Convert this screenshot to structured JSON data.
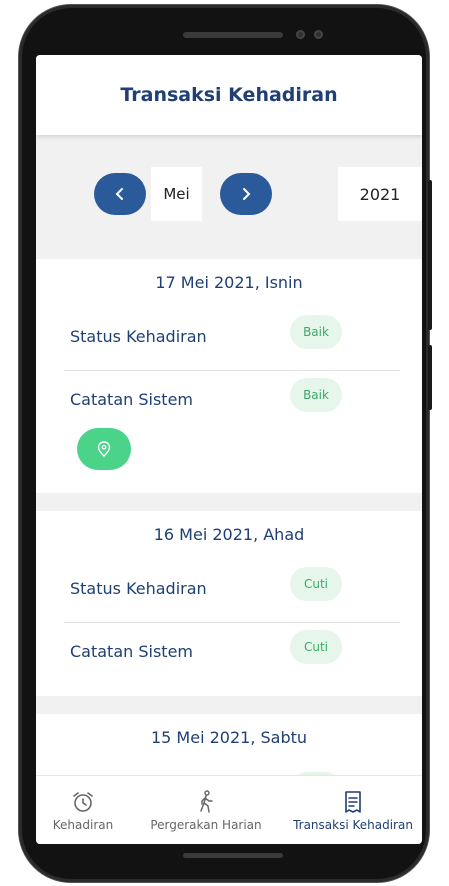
{
  "header": {
    "title": "Transaksi Kehadiran"
  },
  "period": {
    "month": "Mei",
    "year": "2021",
    "prev_icon": "chevron-left-icon",
    "next_icon": "chevron-right-icon"
  },
  "days": [
    {
      "date": "17 Mei 2021, Isnin",
      "rows": [
        {
          "label": "Status Kehadiran",
          "status": "Baik"
        },
        {
          "label": "Catatan Sistem",
          "status": "Baik"
        }
      ],
      "location_icon": "location-pin-icon"
    },
    {
      "date": "16 Mei 2021, Ahad",
      "rows": [
        {
          "label": "Status Kehadiran",
          "status": "Cuti"
        },
        {
          "label": "Catatan Sistem",
          "status": "Cuti"
        }
      ]
    },
    {
      "date": "15 Mei 2021, Sabtu",
      "rows": []
    }
  ],
  "tabs": [
    {
      "label": "Kehadiran",
      "icon": "alarm-clock-icon",
      "active": false
    },
    {
      "label": "Pergerakan Harian",
      "icon": "walking-person-icon",
      "active": false
    },
    {
      "label": "Transaksi Kehadiran",
      "icon": "receipt-icon",
      "active": true
    }
  ],
  "colors": {
    "primary": "#1f3f75",
    "nav_button": "#2b5a9a",
    "chip_bg": "#e6f6ea",
    "chip_text": "#3ca96a",
    "location_button": "#4cd38a"
  }
}
